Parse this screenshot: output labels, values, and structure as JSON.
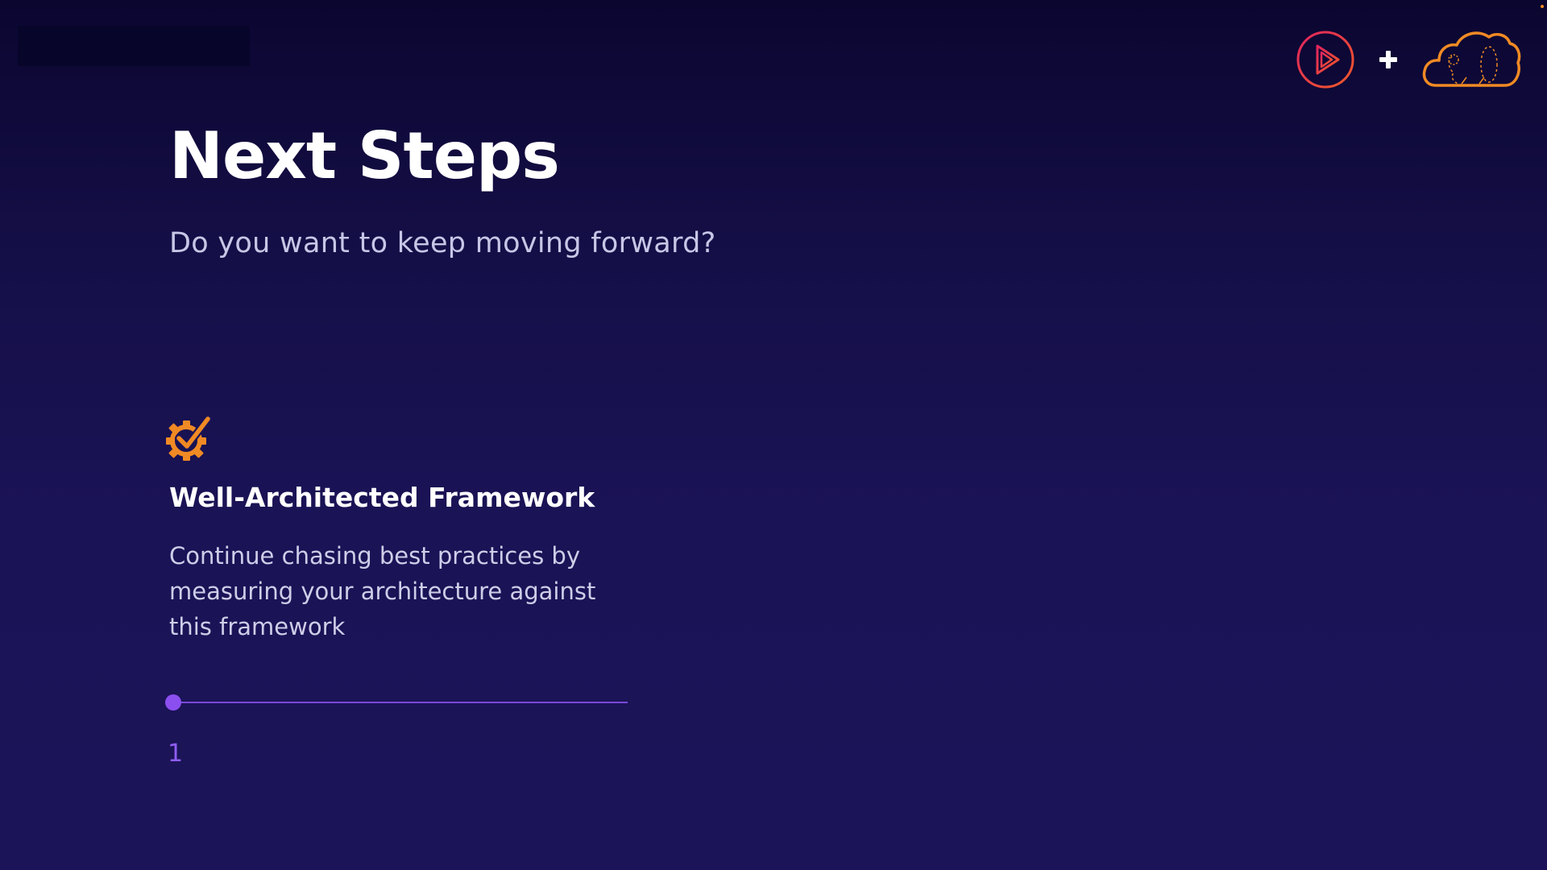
{
  "slide": {
    "title": "Next Steps",
    "subtitle": "Do you want to keep moving forward?",
    "item": {
      "icon": "gear-check-icon",
      "title": "Well-Architected Framework",
      "description": "Continue chasing best practices by measuring your architecture against this framework"
    },
    "progress": {
      "current_step": "1",
      "position": 0
    }
  },
  "logos": {
    "left": "play-logo-icon",
    "separator": "plus-icon",
    "right": "cloud-logo-icon"
  },
  "colors": {
    "background_top": "#0b0630",
    "background_bottom": "#1c1458",
    "accent_orange": "#f08a24",
    "accent_purple": "#8b4ff0",
    "play_gradient_start": "#e0245e",
    "play_gradient_end": "#f05a28"
  }
}
